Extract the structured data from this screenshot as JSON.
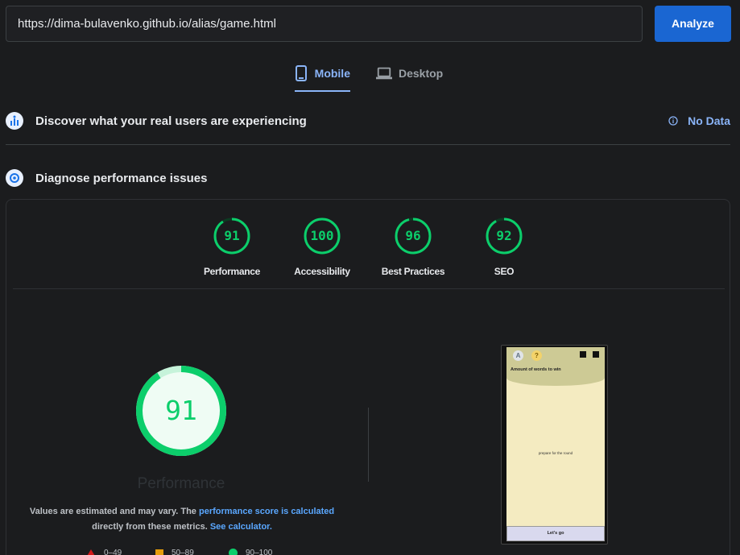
{
  "search": {
    "url": "https://dima-bulavenko.github.io/alias/game.html"
  },
  "toolbar": {
    "analyze_label": "Analyze"
  },
  "tabs": [
    {
      "label": "Mobile",
      "icon": "phone-icon",
      "active": true
    },
    {
      "label": "Desktop",
      "icon": "laptop-icon",
      "active": false
    }
  ],
  "field_data": {
    "title": "Discover what your real users are experiencing",
    "status": "No Data"
  },
  "lab": {
    "title": "Diagnose performance issues"
  },
  "scores": [
    {
      "value": "91",
      "label": "Performance",
      "fraction": 0.91
    },
    {
      "value": "100",
      "label": "Accessibility",
      "fraction": 1.0
    },
    {
      "value": "96",
      "label": "Best Practices",
      "fraction": 0.96
    },
    {
      "value": "92",
      "label": "SEO",
      "fraction": 0.92
    }
  ],
  "main_gauge": {
    "value": "91",
    "label": "Performance",
    "fraction": 0.91
  },
  "note": {
    "text1": "Values are estimated and may vary. The ",
    "link1": "performance score is calculated",
    "text2": "directly from these metrics. ",
    "link2": "See calculator."
  },
  "legend": [
    {
      "range": "0–49",
      "color": "#d41a1a",
      "shape": "triangle"
    },
    {
      "range": "50–89",
      "color": "#e59d0c",
      "shape": "square"
    },
    {
      "range": "90–100",
      "color": "#0cce6b",
      "shape": "circle"
    }
  ],
  "screenshot": {
    "title": "Amount of words to win",
    "center_text": "prepare for the round",
    "button_label": "Let's go",
    "icon_a": "A",
    "icon_q": "?"
  },
  "colors": {
    "accent": "#8ab4f8",
    "pass": "#0cce6b",
    "button": "#1a66d2"
  }
}
